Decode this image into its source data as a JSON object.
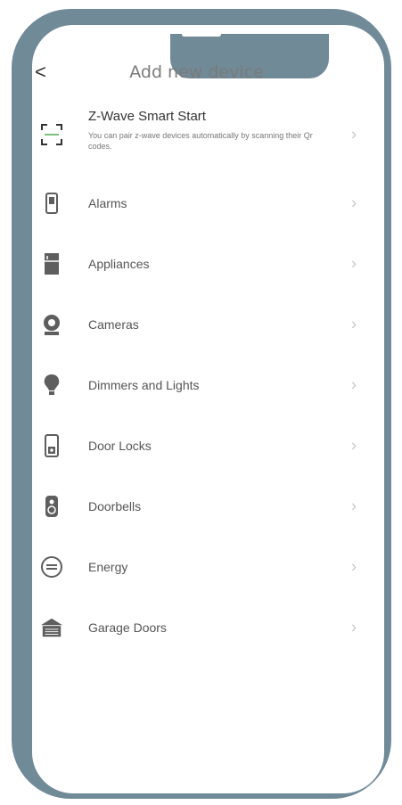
{
  "header": {
    "back_glyph": "<",
    "title": "Add new device"
  },
  "smart_start": {
    "label": "Z-Wave Smart Start",
    "description": "You can pair z-wave devices automatically by scanning their Qr codes.",
    "icon": "qr-scan-icon"
  },
  "items": [
    {
      "label": "Alarms",
      "icon": "alarm-sensor-icon"
    },
    {
      "label": "Appliances",
      "icon": "appliance-icon"
    },
    {
      "label": "Cameras",
      "icon": "camera-icon"
    },
    {
      "label": "Dimmers and Lights",
      "icon": "light-bulb-icon"
    },
    {
      "label": "Door Locks",
      "icon": "door-lock-icon"
    },
    {
      "label": "Doorbells",
      "icon": "doorbell-icon"
    },
    {
      "label": "Energy",
      "icon": "energy-meter-icon"
    },
    {
      "label": "Garage Doors",
      "icon": "garage-door-icon"
    }
  ],
  "chevron_glyph": "›",
  "colors": {
    "frame": "#708a98",
    "icon": "#5e5e5e",
    "text": "#555555"
  }
}
